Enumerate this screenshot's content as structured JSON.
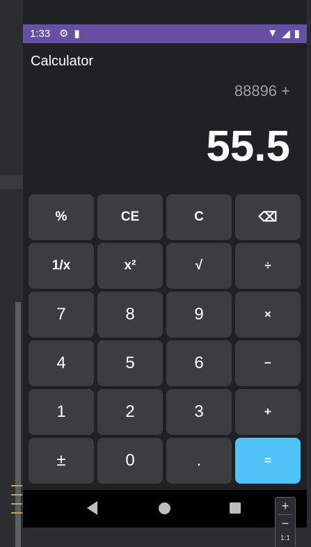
{
  "status_bar": {
    "time": "1:33",
    "left_icons": [
      "gear-icon",
      "sd-card-icon"
    ],
    "right_icons": [
      "wifi-icon",
      "signal-icon",
      "battery-icon"
    ],
    "bg_color": "#6650a4"
  },
  "app": {
    "title": "Calculator"
  },
  "display": {
    "expression": "88896 +",
    "result": "55.5"
  },
  "keys": [
    [
      "%",
      "CE",
      "C",
      "⌫"
    ],
    [
      "1/x",
      "x²",
      "√",
      "÷"
    ],
    [
      "7",
      "8",
      "9",
      "×"
    ],
    [
      "4",
      "5",
      "6",
      "−"
    ],
    [
      "1",
      "2",
      "3",
      "+"
    ],
    [
      "±",
      "0",
      ".",
      "="
    ]
  ],
  "colors": {
    "key_bg": "#3c3d40",
    "equals_bg": "#4fc3f7",
    "app_bg": "#202124"
  },
  "emulator": {
    "zoom_in": "+",
    "zoom_out": "−",
    "zoom_reset": "1:1"
  }
}
